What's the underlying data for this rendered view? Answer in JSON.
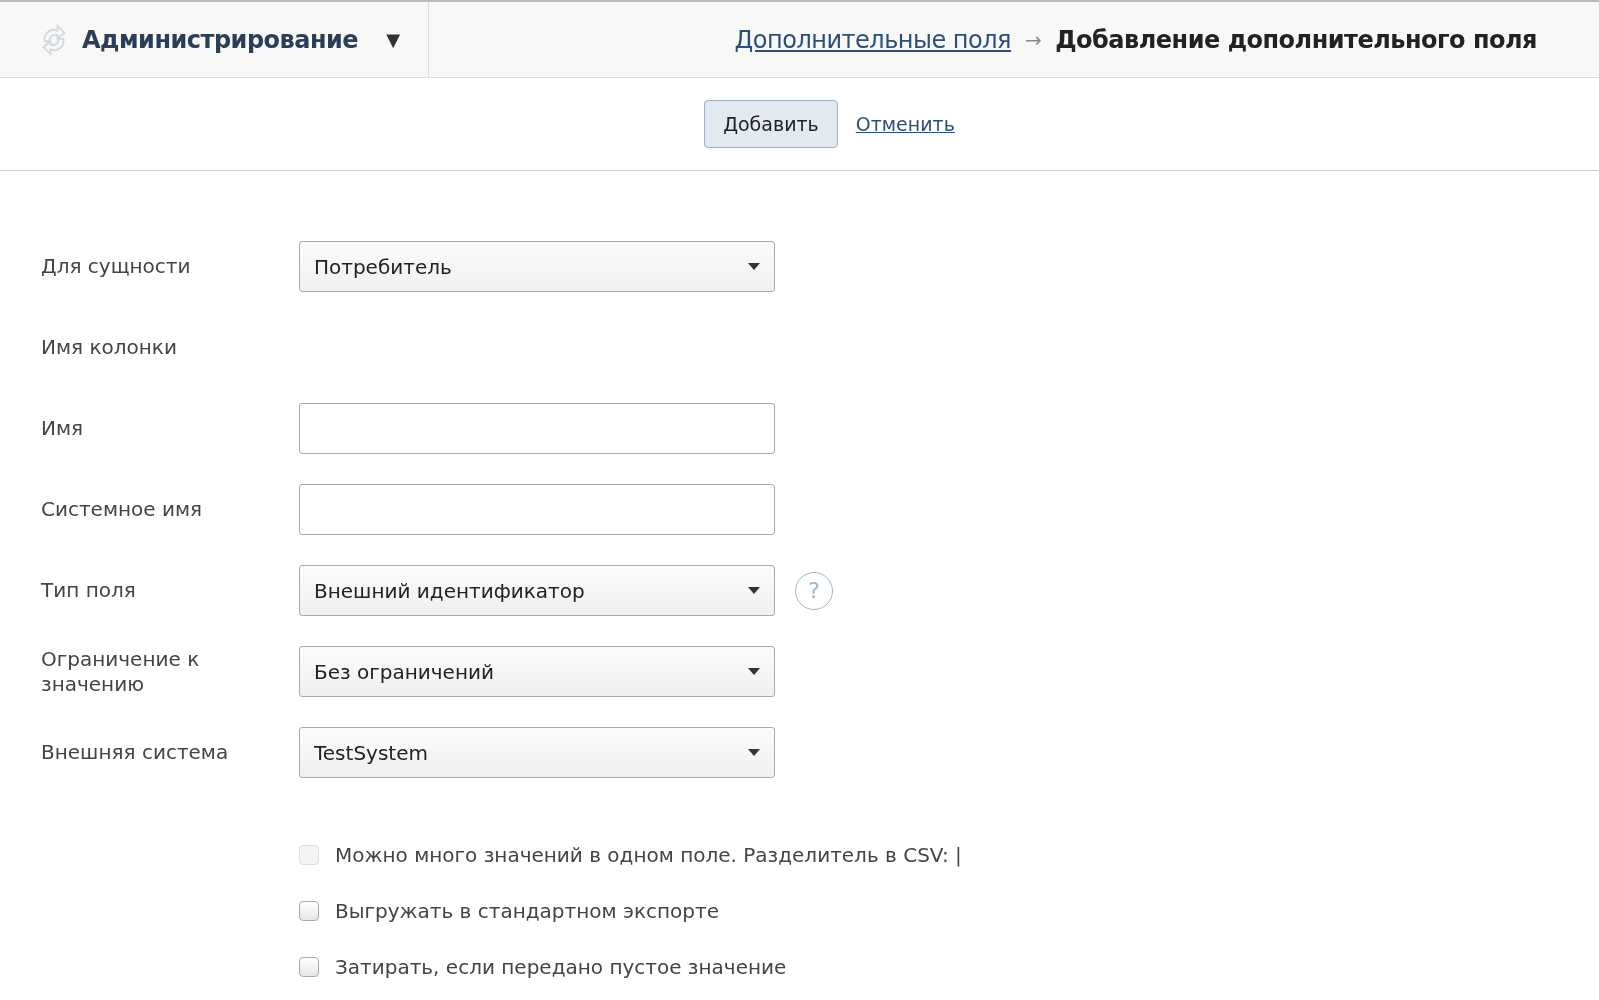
{
  "header": {
    "section": "Администрирование",
    "caret": "▼",
    "breadcrumb": [
      {
        "label": "Дополнительные поля",
        "kind": "link"
      },
      {
        "label": "→",
        "kind": "separator"
      },
      {
        "label": "Добавление дополнительного поля",
        "kind": "current"
      }
    ]
  },
  "toolbar": {
    "buttons": [
      {
        "label": "Добавить",
        "kind": "button"
      },
      {
        "label": "Отменить",
        "kind": "link"
      }
    ]
  },
  "form": {
    "rows": [
      {
        "label": "Для сущности",
        "kind": "select",
        "value": "Потребитель"
      },
      {
        "label": "Имя колонки",
        "kind": "none"
      },
      {
        "label": "Имя",
        "kind": "text"
      },
      {
        "label": "Системное имя",
        "kind": "text"
      },
      {
        "label": "Тип поля",
        "kind": "select",
        "value": "Внешний идентификатор",
        "help": "?"
      },
      {
        "label": "Ограничение к значению",
        "kind": "select",
        "value": "Без ограничений"
      },
      {
        "label": "Внешняя система",
        "kind": "select",
        "value": "TestSystem"
      }
    ],
    "checkboxes": [
      {
        "label": "Можно много значений в одном поле. Разделитель в CSV: |",
        "checked": false,
        "disabled": true
      },
      {
        "label": "Выгружать в стандартном экспорте",
        "checked": false,
        "disabled": false
      },
      {
        "label": "Затирать, если передано пустое значение",
        "checked": false,
        "disabled": false
      }
    ]
  }
}
